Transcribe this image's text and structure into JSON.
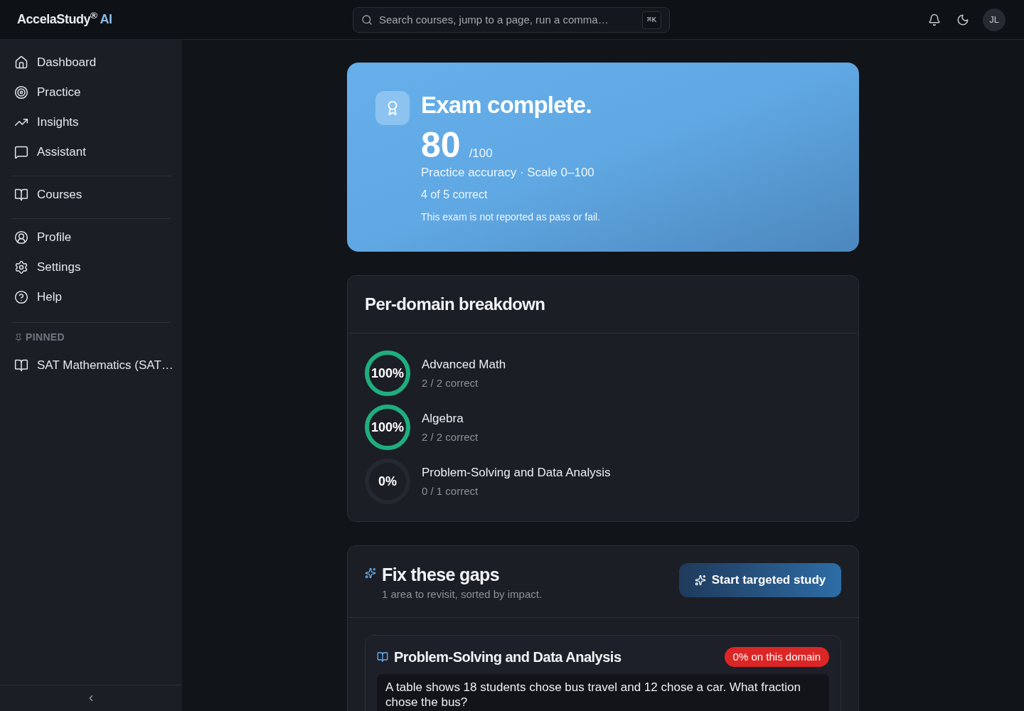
{
  "header": {
    "brand": {
      "name": "AccelaStudy$^{®}$",
      "suffix": "AI"
    },
    "search": {
      "placeholder": "Search courses, jump to a page, run a comma…",
      "shortcut": "⌘K"
    },
    "avatar": "JL"
  },
  "sidebar": {
    "sections": [
      {
        "items": [
          {
            "label": "Dashboard",
            "selected": false
          },
          {
            "label": "Practice",
            "selected": false
          },
          {
            "label": "Insights",
            "selected": false
          },
          {
            "label": "Assistant",
            "selected": false
          }
        ]
      },
      {
        "items": [
          {
            "label": "Courses",
            "selected": false
          }
        ]
      },
      {
        "items": [
          {
            "label": "Profile",
            "selected": false
          },
          {
            "label": "Settings",
            "selected": false
          },
          {
            "label": "Help",
            "selected": false
          }
        ]
      }
    ],
    "pinned": {
      "title": "PINNED",
      "items": [
        {
          "label": "SAT Mathematics (SAT…",
          "selected": false
        }
      ]
    }
  },
  "result": {
    "title": "Exam complete.",
    "score": "80",
    "max": "/100",
    "metric": "Practice accuracy · Scale 0–100",
    "correct": "4 of 5 correct",
    "note": "This exam is not reported as pass or fail."
  },
  "breakdown": {
    "title": "Per-domain breakdown",
    "domains": [
      {
        "percent": "100%",
        "level": 1,
        "name": "Advanced Math",
        "detail": "2 / 2 correct"
      },
      {
        "percent": "100%",
        "level": 1,
        "name": "Algebra",
        "detail": "2 / 2 correct"
      },
      {
        "percent": "0%",
        "level": 0,
        "name": "Problem-Solving and Data Analysis",
        "detail": "0 / 1 correct"
      }
    ]
  },
  "gaps": {
    "title": "Fix these gaps",
    "subtitle": "1 area to revisit, sorted by impact.",
    "button": "Start targeted study",
    "items": [
      {
        "domain": "Problem-Solving and Data Analysis",
        "badge": "0% on this domain",
        "question": "A table shows 18 students chose bus travel and 12 chose a car. What fraction chose the bus?"
      }
    ]
  }
}
